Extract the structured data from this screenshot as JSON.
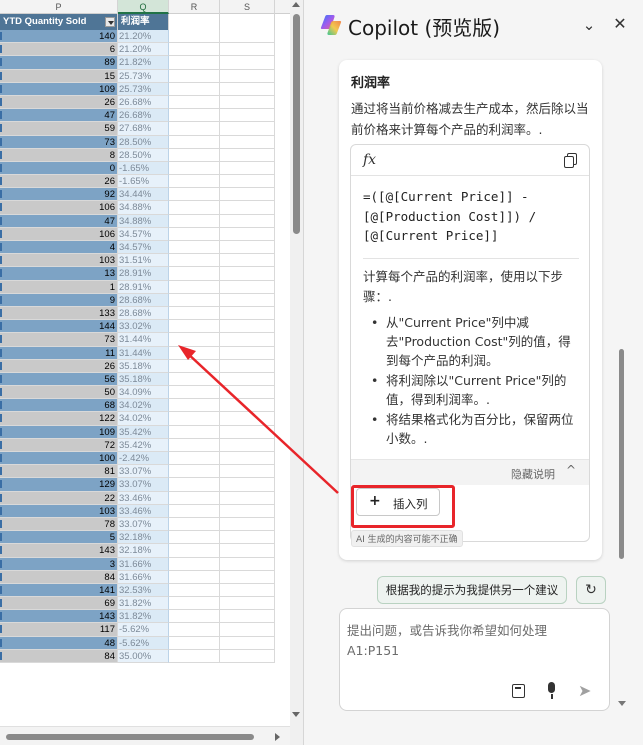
{
  "sheet": {
    "columns": [
      "P",
      "Q",
      "R",
      "S"
    ],
    "selected_column": "Q",
    "headers": {
      "p": "YTD Quantity Sold",
      "q": "利润率"
    },
    "rows": [
      [
        "140",
        "21.20%"
      ],
      [
        "6",
        "21.20%"
      ],
      [
        "89",
        "21.82%"
      ],
      [
        "15",
        "25.73%"
      ],
      [
        "109",
        "25.73%"
      ],
      [
        "26",
        "26.68%"
      ],
      [
        "47",
        "26.68%"
      ],
      [
        "59",
        "27.68%"
      ],
      [
        "73",
        "28.50%"
      ],
      [
        "8",
        "28.50%"
      ],
      [
        "0",
        "-1.65%"
      ],
      [
        "26",
        "-1.65%"
      ],
      [
        "92",
        "34.44%"
      ],
      [
        "106",
        "34.88%"
      ],
      [
        "47",
        "34.88%"
      ],
      [
        "106",
        "34.57%"
      ],
      [
        "4",
        "34.57%"
      ],
      [
        "103",
        "31.51%"
      ],
      [
        "13",
        "28.91%"
      ],
      [
        "1",
        "28.91%"
      ],
      [
        "9",
        "28.68%"
      ],
      [
        "133",
        "28.68%"
      ],
      [
        "144",
        "33.02%"
      ],
      [
        "73",
        "31.44%"
      ],
      [
        "11",
        "31.44%"
      ],
      [
        "26",
        "35.18%"
      ],
      [
        "56",
        "35.18%"
      ],
      [
        "50",
        "34.09%"
      ],
      [
        "68",
        "34.02%"
      ],
      [
        "122",
        "34.02%"
      ],
      [
        "109",
        "35.42%"
      ],
      [
        "72",
        "35.42%"
      ],
      [
        "100",
        "-2.42%"
      ],
      [
        "81",
        "33.07%"
      ],
      [
        "129",
        "33.07%"
      ],
      [
        "22",
        "33.46%"
      ],
      [
        "103",
        "33.46%"
      ],
      [
        "78",
        "33.07%"
      ],
      [
        "5",
        "32.18%"
      ],
      [
        "143",
        "32.18%"
      ],
      [
        "3",
        "31.66%"
      ],
      [
        "84",
        "31.66%"
      ],
      [
        "141",
        "32.53%"
      ],
      [
        "69",
        "31.82%"
      ],
      [
        "143",
        "31.82%"
      ],
      [
        "117",
        "-5.62%"
      ],
      [
        "48",
        "-5.62%"
      ],
      [
        "84",
        "35.00%"
      ]
    ]
  },
  "copilot": {
    "title": "Copilot (预览版)",
    "minimize_icon": "chevron-down-icon",
    "close_icon": "close-icon",
    "card": {
      "title": "利润率",
      "description": "通过将当前价格减去生产成本，然后除以当前价格来计算每个产品的利润率。.",
      "fx_label": "fx",
      "formula": "=([@[Current Price]] - [@[Production Cost]]) / [@[Current Price]]",
      "steps_intro": "计算每个产品的利润率，使用以下步骤：.",
      "steps": [
        "从\"Current Price\"列中减去\"Production Cost\"列的值，得到每个产品的利润。",
        "将利润除以\"Current Price\"列的值，得到利润率。.",
        "将结果格式化为百分比，保留两位小数。."
      ],
      "hide_label": "隐藏说明",
      "insert_button": "插入列",
      "ai_note": "AI 生成的内容可能不正确"
    },
    "suggest_button": "根据我的提示为我提供另一个建议",
    "input_placeholder": "提出问题，或告诉我你希望如何处理 A1:P151"
  },
  "colors": {
    "header_blue": "#4f7596",
    "annotation_red": "#e8252a",
    "selected_column": "#217346"
  }
}
